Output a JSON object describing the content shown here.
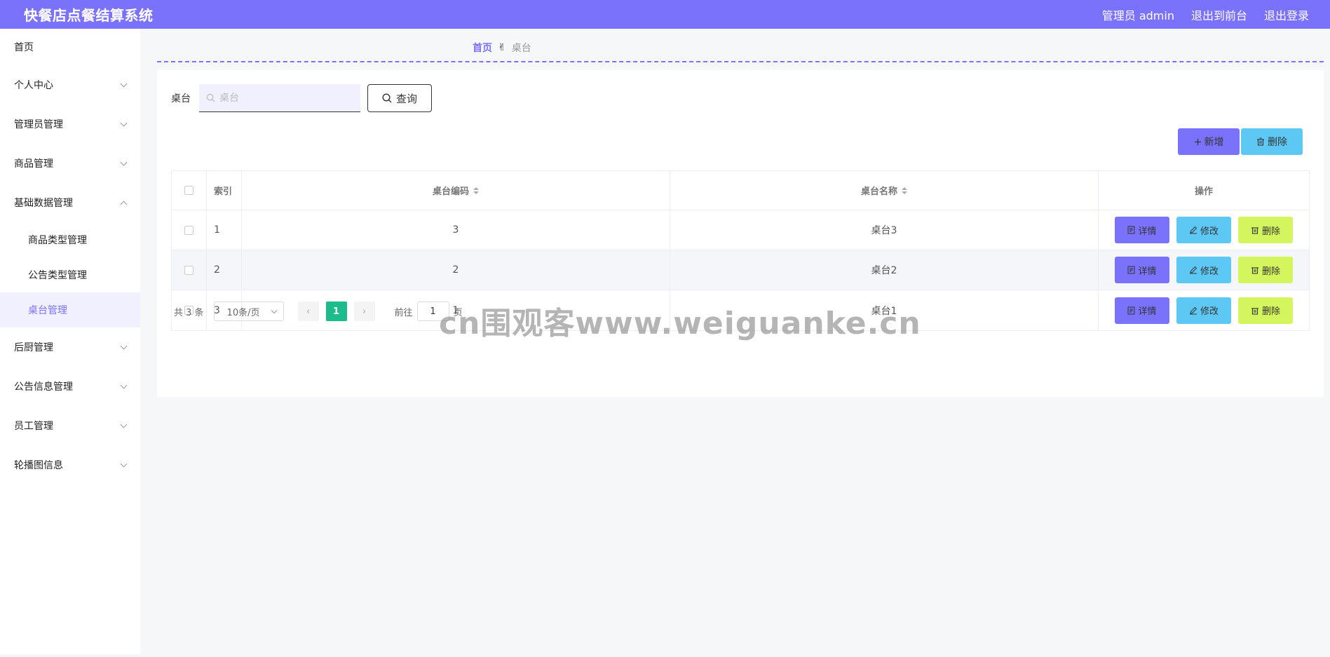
{
  "header": {
    "title": "快餐店点餐结算系统",
    "admin_label": "管理员 admin",
    "front_label": "退出到前台",
    "logout_label": "退出登录"
  },
  "sidebar": {
    "items": [
      {
        "label": "首页"
      },
      {
        "label": "个人中心"
      },
      {
        "label": "管理员管理"
      },
      {
        "label": "商品管理"
      },
      {
        "label": "基础数据管理"
      },
      {
        "label": "商品类型管理"
      },
      {
        "label": "公告类型管理"
      },
      {
        "label": "桌台管理"
      },
      {
        "label": "后厨管理"
      },
      {
        "label": "公告信息管理"
      },
      {
        "label": "员工管理"
      },
      {
        "label": "轮播图信息"
      }
    ]
  },
  "breadcrumb": {
    "home": "首页",
    "current": "桌台"
  },
  "search": {
    "label": "桌台",
    "placeholder": "桌台",
    "value": "",
    "button": "查询"
  },
  "actions": {
    "add": "新增",
    "delete": "删除"
  },
  "table": {
    "columns": [
      "索引",
      "桌台编码",
      "桌台名称",
      "操作"
    ],
    "rows": [
      {
        "index": "1",
        "code": "3",
        "name": "桌台3"
      },
      {
        "index": "2",
        "code": "2",
        "name": "桌台2"
      },
      {
        "index": "3",
        "code": "1",
        "name": "桌台1"
      }
    ],
    "row_actions": {
      "detail": "详情",
      "edit": "修改",
      "delete": "删除"
    }
  },
  "pagination": {
    "total": "共 3 条",
    "page_size": "10条/页",
    "current_page": "1",
    "goto_prefix": "前往",
    "goto_value": "1",
    "goto_suffix": "页"
  },
  "watermark": "cn围观客www.weiguanke.cn",
  "colors": {
    "primary": "#7b72fb",
    "info": "#5ec8f5",
    "danger": "#d4f55e",
    "pager_active": "#1cbc8c"
  }
}
